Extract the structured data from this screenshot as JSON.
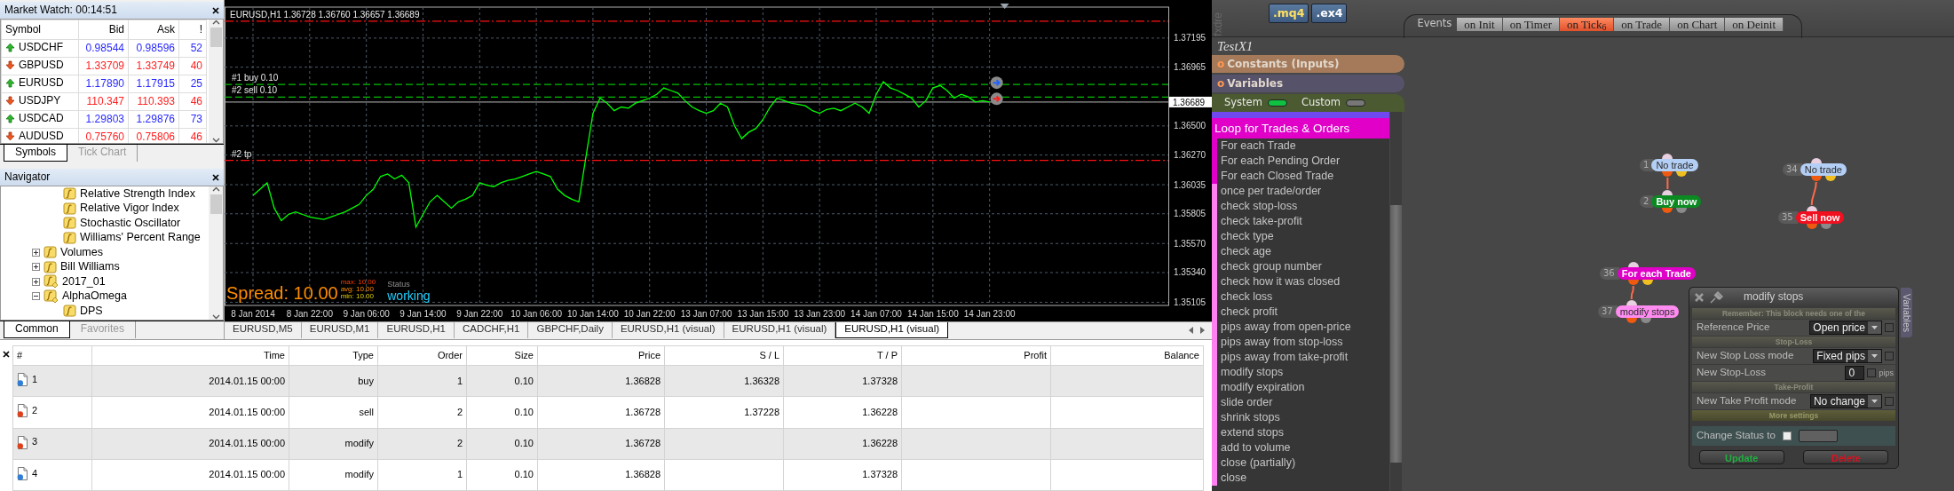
{
  "market_watch": {
    "title": "Market Watch: 00:14:51",
    "columns": [
      "Symbol",
      "Bid",
      "Ask",
      "!"
    ],
    "rows": [
      {
        "symbol": "USDCHF",
        "bid": "0.98544",
        "ask": "0.98596",
        "spread": "52",
        "rising": true
      },
      {
        "symbol": "GBPUSD",
        "bid": "1.33709",
        "ask": "1.33749",
        "spread": "40",
        "rising": false
      },
      {
        "symbol": "EURUSD",
        "bid": "1.17890",
        "ask": "1.17915",
        "spread": "25",
        "rising": true
      },
      {
        "symbol": "USDJPY",
        "bid": "110.347",
        "ask": "110.393",
        "spread": "46",
        "rising": false
      },
      {
        "symbol": "USDCAD",
        "bid": "1.29803",
        "ask": "1.29876",
        "spread": "73",
        "rising": true
      },
      {
        "symbol": "AUDUSD",
        "bid": "0.75760",
        "ask": "0.75806",
        "spread": "46",
        "rising": false
      }
    ],
    "tabs": [
      {
        "label": "Symbols",
        "selected": true
      },
      {
        "label": "Tick Chart",
        "selected": false
      }
    ]
  },
  "navigator": {
    "title": "Navigator",
    "tree": [
      {
        "children": [
          {
            "label": "Relative Strength Index",
            "kind": "indicator"
          },
          {
            "label": "Relative Vigor Index",
            "kind": "indicator"
          },
          {
            "label": "Stochastic Oscillator",
            "kind": "indicator"
          },
          {
            "label": "Williams' Percent Range",
            "kind": "indicator"
          }
        ]
      },
      {
        "label": "Volumes",
        "kind": "indicator",
        "expanded": false
      },
      {
        "label": "Bill Williams",
        "kind": "indicator",
        "expanded": false
      },
      {
        "label": "2017_01",
        "kind": "expert",
        "expanded": false
      },
      {
        "label": "AlphaOmega",
        "kind": "expert",
        "expanded": true,
        "children": [
          {
            "label": "DPS",
            "kind": "indicator"
          }
        ]
      }
    ],
    "tabs": [
      {
        "label": "Common",
        "selected": true
      },
      {
        "label": "Favorites",
        "selected": false
      }
    ]
  },
  "chart": {
    "chart_data": {
      "type": "line",
      "title": "EURUSD,H1  1.36728 1.36760 1.36657 1.36689",
      "categories": [
        "8 Jan 2014",
        null,
        null,
        null,
        null,
        null,
        null,
        null,
        "8 Jan 22:00",
        null,
        null,
        null,
        null,
        null,
        null,
        null,
        "9 Jan 06:00",
        null,
        null,
        null,
        null,
        null,
        null,
        null,
        "9 Jan 14:00",
        null,
        null,
        null,
        null,
        null,
        null,
        null,
        "9 Jan 22:00",
        null,
        null,
        null,
        null,
        null,
        null,
        null,
        "10 Jan 06:00",
        null,
        null,
        null,
        null,
        null,
        null,
        null,
        "10 Jan 14:00",
        null,
        null,
        null,
        null,
        null,
        null,
        null,
        "10 Jan 22:00",
        null,
        null,
        null,
        null,
        null,
        null,
        null,
        "13 Jan 07:00",
        null,
        null,
        null,
        null,
        null,
        null,
        null,
        "13 Jan 15:00",
        null,
        null,
        null,
        null,
        null,
        null,
        null,
        "13 Jan 23:00",
        null,
        null,
        null,
        null,
        null,
        null,
        null,
        "14 Jan 07:00",
        null,
        null,
        null,
        null,
        null,
        null,
        null,
        "14 Jan 15:00",
        null,
        null,
        null,
        null,
        null,
        null,
        null,
        "14 Jan 23:00"
      ],
      "series": [
        {
          "color": "#00ff00",
          "values": [
            1.3595,
            1.36,
            1.3605,
            1.3585,
            1.3575,
            1.358,
            1.3582,
            1.358,
            1.3578,
            1.3577,
            1.3576,
            1.3578,
            1.358,
            1.3582,
            1.3585,
            1.3588,
            1.3595,
            1.36,
            1.361,
            1.3612,
            1.3608,
            1.3611,
            1.3605,
            1.357,
            1.358,
            1.359,
            1.3595,
            1.359,
            1.3585,
            1.359,
            1.3592,
            1.3595,
            1.3605,
            1.3603,
            1.3602,
            1.3605,
            1.3607,
            1.3608,
            1.361,
            1.3612,
            1.3614,
            1.3612,
            1.361,
            1.36,
            1.3595,
            1.3592,
            1.359,
            1.3625,
            1.366,
            1.3672,
            1.3668,
            1.3662,
            1.3665,
            1.3664,
            1.3668,
            1.367,
            1.3672,
            1.3675,
            1.368,
            1.3678,
            1.3676,
            1.367,
            1.3665,
            1.3662,
            1.366,
            1.3662,
            1.3668,
            1.3665,
            1.365,
            1.364,
            1.3645,
            1.3648,
            1.3655,
            1.3665,
            1.3672,
            1.367,
            1.3668,
            1.3667,
            1.3666,
            1.3662,
            1.366,
            1.3663,
            1.3664,
            1.3662,
            1.3665,
            1.3668,
            1.3665,
            1.366,
            1.3675,
            1.3685,
            1.368,
            1.3678,
            1.3675,
            1.3672,
            1.3665,
            1.367,
            1.368,
            1.3682,
            1.3678,
            1.3672,
            1.3675,
            1.3673,
            1.3669,
            1.367,
            1.36689
          ]
        }
      ],
      "ylim": [
        1.3508,
        1.3744
      ],
      "grid": true,
      "yticks": [
        {
          "value": 1.37195,
          "label": "1.37195"
        },
        {
          "value": 1.36965,
          "label": "1.36965"
        },
        {
          "value": 1.365,
          "label": "1.36500"
        },
        {
          "value": 1.3627,
          "label": "1.36270"
        },
        {
          "value": 1.36035,
          "label": "1.36035"
        },
        {
          "value": 1.35805,
          "label": "1.35805"
        },
        {
          "value": 1.3557,
          "label": "1.35570"
        },
        {
          "value": 1.3534,
          "label": "1.35340"
        },
        {
          "value": 1.35105,
          "label": "1.35105"
        }
      ],
      "ref_lines": [
        {
          "axis": "y",
          "value": 1.37328,
          "color": "#ff1010"
        },
        {
          "axis": "y",
          "value": 1.36828,
          "label": "#1 buy 0.10",
          "color": "#00c000"
        },
        {
          "axis": "y",
          "value": 1.36728,
          "label": "#2 sell 0.10",
          "color": "#00c000"
        },
        {
          "axis": "y",
          "value": 1.36689,
          "label": "1.36689",
          "color": "#b8b8b8"
        },
        {
          "axis": "y",
          "value": 1.36228,
          "label": "#2 tp",
          "color": "#ff1010"
        }
      ]
    },
    "spread": {
      "label": "Spread: 10.00",
      "stats": [
        {
          "label": "max: 10.00",
          "kind": "max"
        },
        {
          "label": "avg: 10.00",
          "kind": "avg"
        },
        {
          "label": "min: 10.00",
          "kind": "min"
        }
      ],
      "status_label": "Status",
      "status": "working"
    }
  },
  "chart_tabs": [
    {
      "label": "EURUSD,M5",
      "selected": false
    },
    {
      "label": "EURUSD,M1",
      "selected": false
    },
    {
      "label": "EURUSD,H1",
      "selected": false
    },
    {
      "label": "CADCHF,H1",
      "selected": false
    },
    {
      "label": "GBPCHF,Daily",
      "selected": false
    },
    {
      "label": "EURUSD,H1 (visual)",
      "selected": false
    },
    {
      "label": "EURUSD,H1 (visual)",
      "selected": false
    },
    {
      "label": "EURUSD,H1 (visual)",
      "selected": true
    }
  ],
  "trades": {
    "columns": [
      "#",
      "Time",
      "Type",
      "Order",
      "Size",
      "Price",
      "S / L",
      "T / P",
      "Profit",
      "Balance"
    ],
    "rows": [
      {
        "color": "#2f7fd8",
        "cells": [
          "1",
          "2014.01.15 00:00",
          "buy",
          "1",
          "0.10",
          "1.36828",
          "1.36328",
          "1.37328"
        ]
      },
      {
        "color": "#e0401c",
        "cells": [
          "2",
          "2014.01.15 00:00",
          "sell",
          "2",
          "0.10",
          "1.36728",
          "1.37228",
          "1.36228"
        ]
      },
      {
        "color": "#e0401c",
        "cells": [
          "3",
          "2014.01.15 00:00",
          "modify",
          "2",
          "0.10",
          "1.36728",
          "",
          "1.36228"
        ]
      },
      {
        "color": "#2f7fd8",
        "cells": [
          "4",
          "2014.01.15 00:00",
          "modify",
          "1",
          "0.10",
          "1.36828",
          "",
          "1.37328"
        ]
      }
    ]
  },
  "builder": {
    "logo": "fxdre",
    "file_buttons": [
      {
        "label": ".mq4",
        "kind": "mq4"
      },
      {
        "label": ".ex4",
        "kind": "ex4"
      }
    ],
    "events_label": "Events",
    "event_tabs": [
      {
        "label": "on Init",
        "selected": false
      },
      {
        "label": "on Timer",
        "selected": false
      },
      {
        "label": "on Tick$_{6}$",
        "selected": true
      },
      {
        "label": "on Trade",
        "selected": false
      },
      {
        "label": "on Chart",
        "selected": false
      },
      {
        "label": "on Deinit",
        "selected": false
      }
    ],
    "project": "TestX1",
    "sections": [
      {
        "bullet": "o",
        "label": "Constants (Inputs)",
        "color": "#a47a5a"
      },
      {
        "bullet": "o",
        "label": "Variables",
        "color": "#56526a"
      }
    ],
    "switches": [
      {
        "label": "System",
        "on": true
      },
      {
        "label": "Custom",
        "on": false
      }
    ],
    "category": "Loop for Trades & Orders",
    "blocks": [
      {
        "label": "For each Trade",
        "kind": "loop"
      },
      {
        "label": "For each Pending Order",
        "kind": "loop"
      },
      {
        "label": "For each Closed Trade",
        "kind": "loop"
      },
      {
        "label": "once per trade/order",
        "kind": "action"
      },
      {
        "label": "check stop-loss",
        "kind": "action"
      },
      {
        "label": "check take-profit",
        "kind": "action"
      },
      {
        "label": "check type",
        "kind": "action"
      },
      {
        "label": "check age",
        "kind": "action"
      },
      {
        "label": "check group number",
        "kind": "action"
      },
      {
        "label": "check how it was closed",
        "kind": "action"
      },
      {
        "label": "check loss",
        "kind": "action"
      },
      {
        "label": "check profit",
        "kind": "action"
      },
      {
        "label": "pips away from open-price",
        "kind": "action"
      },
      {
        "label": "pips away from stop-loss",
        "kind": "action"
      },
      {
        "label": "pips away from take-profit",
        "kind": "action"
      },
      {
        "label": "modify stops",
        "kind": "action"
      },
      {
        "label": "modify expiration",
        "kind": "action"
      },
      {
        "label": "slide order",
        "kind": "action"
      },
      {
        "label": "shrink stops",
        "kind": "action"
      },
      {
        "label": "extend stops",
        "kind": "action"
      },
      {
        "label": "add to volume",
        "kind": "action"
      },
      {
        "label": "close (partially)",
        "kind": "action"
      },
      {
        "label": "close",
        "kind": "action"
      }
    ],
    "nodes": [
      {
        "number": "1",
        "label": "No trade",
        "color": "#b4cff5",
        "kind": "condition",
        "children": [
          {
            "number": "2",
            "label": "Buy now",
            "color": "#0b8a22",
            "kind": "action"
          }
        ]
      },
      {
        "number": "34",
        "label": "No trade",
        "color": "#b4cff5",
        "kind": "condition",
        "children": [
          {
            "number": "35",
            "label": "Sell now",
            "color": "#f01020",
            "kind": "action"
          }
        ]
      },
      {
        "number": "36",
        "label": "For each Trade",
        "color": "#e000c8",
        "kind": "condition",
        "children": [
          {
            "number": "37",
            "label": "modify stops",
            "color": "#ff8cf0",
            "kind": "action"
          }
        ]
      }
    ],
    "dialog": {
      "title": "modify stops",
      "note": "Remember: This block needs one of the",
      "rows": [
        {
          "kind": "select",
          "label": "Reference Price",
          "value": "Open price",
          "checked": false
        },
        {
          "kind": "heading",
          "label": "Stop-Loss"
        },
        {
          "kind": "select",
          "label": "New Stop Loss mode",
          "value": "Fixed pips",
          "checked": false
        },
        {
          "kind": "number",
          "label": "New Stop-Loss",
          "value": "0",
          "unit": "pips",
          "checked": false
        },
        {
          "kind": "heading",
          "label": "Take-Profit"
        },
        {
          "kind": "select",
          "label": "New Take Profit mode",
          "value": "No change",
          "checked": false
        },
        {
          "kind": "expander",
          "label": "More settings"
        },
        {
          "kind": "status",
          "label": "Change Status to",
          "checked": false
        }
      ],
      "buttons": [
        {
          "label": "Update",
          "kind": "confirm"
        },
        {
          "label": "Delete",
          "kind": "danger"
        }
      ]
    },
    "side_tab": "Variables"
  }
}
